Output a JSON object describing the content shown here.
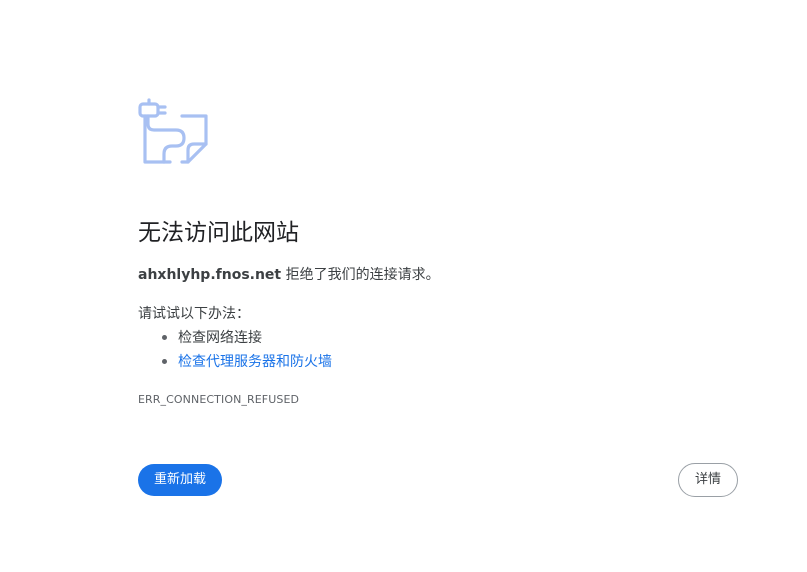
{
  "error": {
    "icon": "unplugged-cable-page-icon",
    "icon_color": "#a8c0f2",
    "title": "无法访问此网站",
    "host": "ahxhlyhp.fnos.net",
    "message_suffix": " 拒绝了我们的连接请求。",
    "suggestions_heading": "请试试以下办法：",
    "suggestions": [
      {
        "label": "检查网络连接",
        "is_link": false
      },
      {
        "label": "检查代理服务器和防火墙",
        "is_link": true
      }
    ],
    "code": "ERR_CONNECTION_REFUSED"
  },
  "buttons": {
    "reload_label": "重新加载",
    "details_label": "详情"
  },
  "colors": {
    "accent": "#1a73e8",
    "text": "#202124",
    "secondary_text": "#3c4043",
    "muted_text": "#5f6368"
  }
}
